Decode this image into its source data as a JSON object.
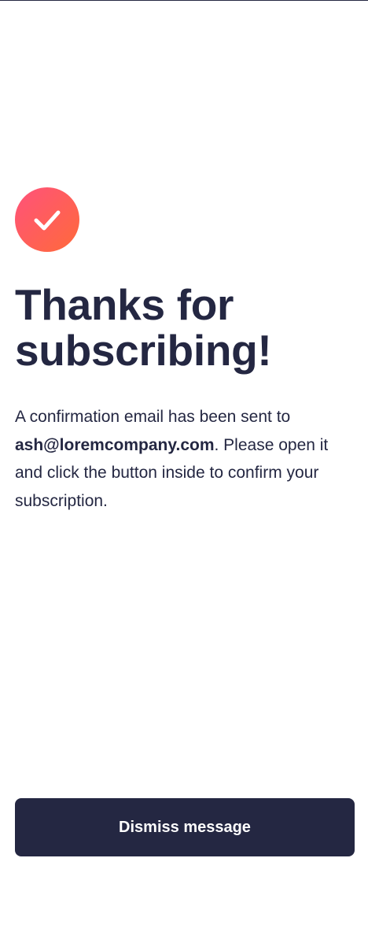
{
  "icons": {
    "success": "checkmark-icon"
  },
  "colors": {
    "navy": "#242742",
    "gradient_start": "#ff527b",
    "gradient_end": "#ff6a3a",
    "background": "#ffffff"
  },
  "success": {
    "title": "Thanks for subscribing!",
    "message_before": "A confirmation email has been sent to ",
    "email": "ash@loremcompany.com",
    "message_after": ". Please open it and click the button inside to confirm your subscription.",
    "dismiss_label": "Dismiss message"
  }
}
